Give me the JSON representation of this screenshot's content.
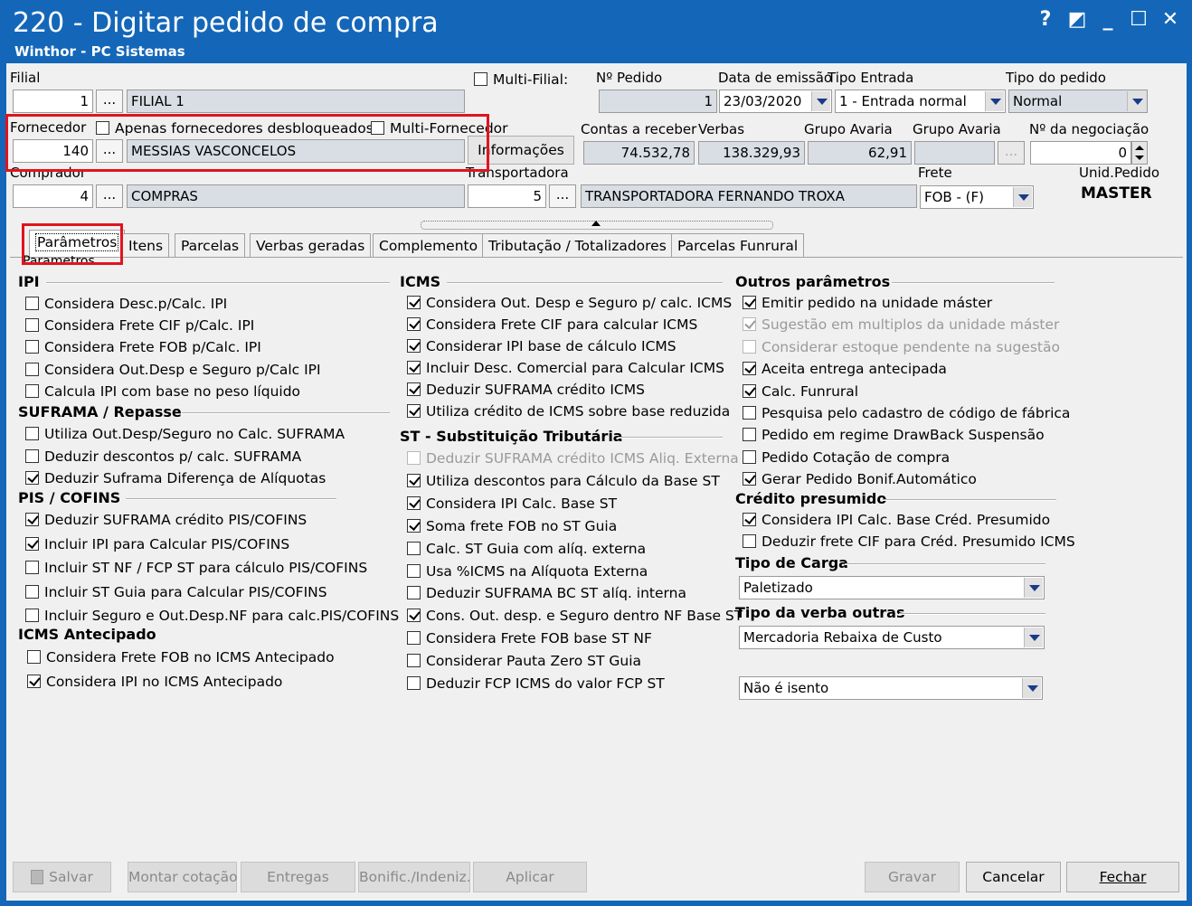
{
  "window": {
    "title": "220 - Digitar pedido de compra",
    "subtitle": "Winthor - PC Sistemas",
    "controls": {
      "help": "?",
      "restore": "◩",
      "minimize": "_",
      "maximize": "☐",
      "close": "✕"
    }
  },
  "header": {
    "filial_label": "Filial",
    "filial_code": "1",
    "filial_name": "FILIAL 1",
    "multi_filial_label": "Multi-Filial:",
    "num_pedido_label": "Nº Pedido",
    "num_pedido": "1",
    "data_emissao_label": "Data de emissão",
    "data_emissao": "23/03/2020",
    "tipo_entrada_label": "Tipo Entrada",
    "tipo_entrada": "1 - Entrada normal",
    "tipo_pedido_label": "Tipo do pedido",
    "tipo_pedido": "Normal",
    "fornecedor_label": "Fornecedor",
    "apenas_desbloq_label": "Apenas fornecedores desbloqueados",
    "multi_fornecedor_label": "Multi-Fornecedor",
    "fornecedor_code": "140",
    "fornecedor_name": "MESSIAS VASCONCELOS",
    "informacoes_label": "Informações",
    "contas_receber_label": "Contas a receber",
    "contas_receber": "74.532,78",
    "verbas_label": "Verbas",
    "verbas": "138.329,93",
    "grupo_avaria_label": "Grupo Avaria",
    "grupo_avaria_value": "62,91",
    "grupo_avaria2_label": "Grupo Avaria",
    "grupo_avaria2_value": "",
    "num_negociacao_label": "Nº da negociação",
    "num_negociacao": "0",
    "comprador_label": "Comprador",
    "comprador_code": "4",
    "comprador_name": "COMPRAS",
    "transportadora_label": "Transportadora",
    "transportadora_code": "5",
    "transportadora_name": "TRANSPORTADORA FERNANDO TROXA",
    "frete_label": "Frete",
    "frete": "FOB - (F)",
    "unid_pedido_label": "Unid.Pedido",
    "unid_pedido": "MASTER",
    "dots": "..."
  },
  "tabs": [
    "Parâmetros",
    "Itens",
    "Parcelas",
    "Verbas geradas",
    "Complemento",
    "Tributação / Totalizadores",
    "Parcelas Funrural"
  ],
  "panel_caption": "Parametros",
  "sections": {
    "ipi": {
      "title": "IPI",
      "items": [
        {
          "label": "Considera Desc.p/Calc. IPI",
          "checked": false
        },
        {
          "label": "Considera Frete CIF p/Calc. IPI",
          "checked": false
        },
        {
          "label": "Considera Frete FOB p/Calc. IPI",
          "checked": false
        },
        {
          "label": "Considera Out.Desp e Seguro p/Calc IPI",
          "checked": false
        },
        {
          "label": "Calcula IPI com base no peso líquido",
          "checked": false
        }
      ]
    },
    "suframa": {
      "title": "SUFRAMA / Repasse",
      "items": [
        {
          "label": "Utiliza Out.Desp/Seguro no Calc. SUFRAMA",
          "checked": false
        },
        {
          "label": "Deduzir descontos p/ calc. SUFRAMA",
          "checked": false
        },
        {
          "label": "Deduzir Suframa Diferença de Alíquotas",
          "checked": true
        }
      ]
    },
    "pis": {
      "title": "PIS / COFINS",
      "items": [
        {
          "label": "Deduzir SUFRAMA crédito PIS/COFINS",
          "checked": true
        },
        {
          "label": "Incluir IPI para Calcular PIS/COFINS",
          "checked": true
        },
        {
          "label": "Incluir ST NF / FCP ST para cálculo PIS/COFINS",
          "checked": false
        },
        {
          "label": "Incluir ST Guia para Calcular PIS/COFINS",
          "checked": false
        },
        {
          "label": "Incluir Seguro e Out.Desp.NF para calc.PIS/COFINS",
          "checked": false
        }
      ]
    },
    "icms_ant": {
      "title": "ICMS Antecipado",
      "items": [
        {
          "label": "Considera Frete FOB no ICMS Antecipado",
          "checked": false
        },
        {
          "label": "Considera IPI no ICMS Antecipado",
          "checked": true
        }
      ]
    },
    "icms": {
      "title": "ICMS",
      "items": [
        {
          "label": "Considera Out. Desp e Seguro p/ calc. ICMS",
          "checked": true
        },
        {
          "label": "Considera Frete CIF para calcular ICMS",
          "checked": true
        },
        {
          "label": "Considerar IPI base de cálculo ICMS",
          "checked": true
        },
        {
          "label": "Incluir Desc. Comercial  para Calcular ICMS",
          "checked": true
        },
        {
          "label": "Deduzir SUFRAMA crédito ICMS",
          "checked": true
        },
        {
          "label": "Utiliza crédito de ICMS sobre base reduzida",
          "checked": true
        }
      ]
    },
    "st": {
      "title": "ST - Substituição Tributária",
      "items": [
        {
          "label": "Deduzir SUFRAMA crédito ICMS Aliq. Externa",
          "checked": false,
          "disabled": true
        },
        {
          "label": "Utiliza descontos para Cálculo da Base ST",
          "checked": true
        },
        {
          "label": "Considera IPI Calc. Base ST",
          "checked": true
        },
        {
          "label": "Soma frete FOB no ST Guia",
          "checked": true
        },
        {
          "label": "Calc. ST Guia com alíq. externa",
          "checked": false
        },
        {
          "label": "Usa %ICMS na Alíquota Externa",
          "checked": false
        },
        {
          "label": "Deduzir SUFRAMA BC ST alíq. interna",
          "checked": false
        },
        {
          "label": "Cons. Out. desp. e Seguro dentro NF Base ST",
          "checked": true
        },
        {
          "label": "Considera Frete FOB base ST NF",
          "checked": false
        },
        {
          "label": "Considerar Pauta Zero ST Guia",
          "checked": false
        },
        {
          "label": "Deduzir FCP ICMS do valor FCP ST",
          "checked": false
        }
      ]
    },
    "outros": {
      "title": "Outros parâmetros",
      "items": [
        {
          "label": "Emitir pedido na unidade máster",
          "checked": true
        },
        {
          "label": "Sugestão em multiplos da unidade máster",
          "checked": true,
          "disabled": true
        },
        {
          "label": "Considerar estoque pendente na sugestão",
          "checked": false,
          "disabled": true
        },
        {
          "label": "Aceita entrega antecipada",
          "checked": true
        },
        {
          "label": "Calc. Funrural",
          "checked": true
        },
        {
          "label": "Pesquisa pelo cadastro de código de fábrica",
          "checked": false
        },
        {
          "label": "Pedido em regime DrawBack Suspensão",
          "checked": false
        },
        {
          "label": "Pedido Cotação de compra",
          "checked": false
        },
        {
          "label": "Gerar Pedido Bonif.Automático",
          "checked": true
        }
      ]
    },
    "credito": {
      "title": "Crédito presumido",
      "items": [
        {
          "label": "Considera IPI Calc. Base Créd. Presumido",
          "checked": true
        },
        {
          "label": "Deduzir frete CIF para Créd. Presumido ICMS",
          "checked": false
        }
      ]
    },
    "tipo_carga": {
      "title": "Tipo de Carga",
      "value": "Paletizado"
    },
    "tipo_verba": {
      "title": "Tipo da verba outras",
      "value": "Mercadoria Rebaixa de Custo"
    },
    "isento": {
      "value": "Não é isento"
    }
  },
  "buttons": {
    "salvar": "Salvar",
    "montar": "Montar cotação",
    "entregas": "Entregas",
    "bonific": "Bonific./Indeniz.",
    "aplicar": "Aplicar",
    "gravar": "Gravar",
    "cancelar": "Cancelar",
    "fechar": "Fechar"
  }
}
